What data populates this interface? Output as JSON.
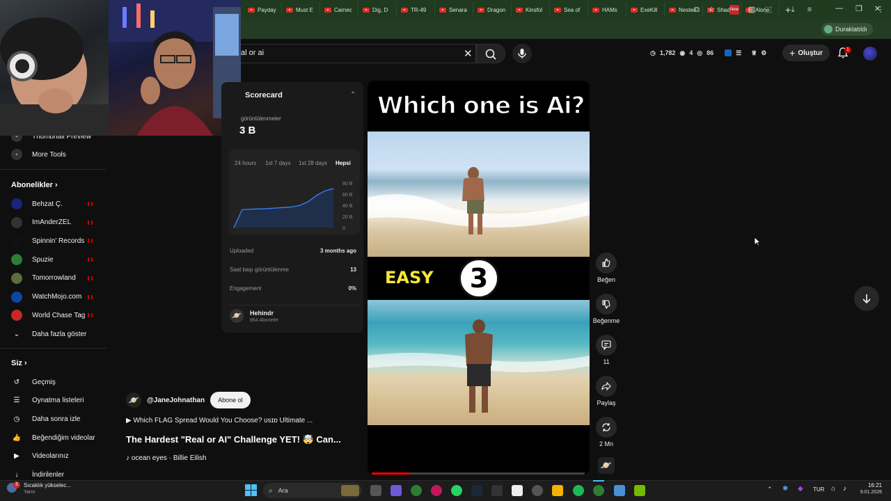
{
  "browser": {
    "tabs": [
      "Payday",
      "Must E",
      "Carnec",
      "Dig, D",
      "TR-49",
      "Senara",
      "Dragon",
      "Kinsfol",
      "Sea of",
      "HAMs",
      "ExeKill",
      "Nestec",
      "Shado",
      "Alone"
    ],
    "profile_label": "Duraklatıldı",
    "new_badge": "New"
  },
  "header": {
    "search_value": "al or ai",
    "stats": {
      "views": "1,782",
      "likes": "4",
      "watchers": "86"
    },
    "create_label": "Oluştur",
    "notification_count": "1"
  },
  "sidebar": {
    "top_items": [
      {
        "label": "Thumbnail Preview",
        "icon": "tool-icon"
      },
      {
        "label": "More Tools",
        "icon": "tool-icon"
      }
    ],
    "subscriptions_title": "Abonelikler",
    "subscriptions": [
      {
        "label": "Behzat Ç.",
        "color": "#1a237e"
      },
      {
        "label": "ImAnderZEL",
        "color": "#333333"
      },
      {
        "label": "Spinnin' Records",
        "color": "#111111"
      },
      {
        "label": "Spuzie",
        "color": "#2e7d32"
      },
      {
        "label": "Tomorrowland",
        "color": "#5d6d3a"
      },
      {
        "label": "WatchMojo.com",
        "color": "#0d47a1"
      },
      {
        "label": "World Chase Tag",
        "color": "#c62828"
      }
    ],
    "show_more_label": "Daha fazla göster",
    "you_title": "Siz",
    "you_items": [
      {
        "label": "Geçmiş",
        "icon": "history-icon"
      },
      {
        "label": "Oynatma listeleri",
        "icon": "playlist-icon"
      },
      {
        "label": "Daha sonra izle",
        "icon": "clock-icon"
      },
      {
        "label": "Beğendiğim videolar",
        "icon": "like-icon"
      },
      {
        "label": "Videolarınız",
        "icon": "video-icon"
      },
      {
        "label": "İndirilenler",
        "icon": "download-icon"
      }
    ]
  },
  "scorecard": {
    "title": "Scorecard",
    "views_label": "görüntülenmeler",
    "views_value": "3 B",
    "ranges": [
      "24 hours",
      "1st 7 days",
      "1st 28 days",
      "Hepsi"
    ],
    "active_range": "Hepsi",
    "rows": [
      {
        "label": "Uploaded",
        "value": "3 months ago"
      },
      {
        "label": "Saat başı görüntülenme",
        "value": "13"
      },
      {
        "label": "Engagement",
        "value": "0%"
      }
    ],
    "channel_name": "Hehindr",
    "channel_subs": "864 Aboneler"
  },
  "chart_data": {
    "type": "area",
    "title": "",
    "ytick_labels": [
      "80 B",
      "60 B",
      "40 B",
      "20 B",
      "0"
    ],
    "ylim": [
      0,
      80
    ],
    "x": [
      0,
      1,
      2,
      3,
      4,
      5,
      6,
      7,
      8,
      9,
      10,
      11,
      12
    ],
    "values": [
      0,
      32,
      33,
      33.5,
      34,
      35,
      36,
      37,
      40,
      47,
      58,
      66,
      70
    ]
  },
  "video": {
    "headline": "Which one is Ai?",
    "easy_label": "EASY",
    "round_number": "3",
    "progress": 0.18
  },
  "actions": [
    {
      "label": "Beğen",
      "icon": "thumbs-up-icon"
    },
    {
      "label": "Beğenme",
      "icon": "thumbs-down-icon"
    },
    {
      "label": "11",
      "icon": "comment-icon"
    },
    {
      "label": "Paylaş",
      "icon": "share-icon"
    },
    {
      "label": "2 Mn",
      "icon": "remix-icon"
    }
  ],
  "meta": {
    "channel_handle": "@JaneJohnathan",
    "subscribe_label": "Abone ol",
    "related": "▶ Which FLAG Spread Would You Choose? υѕɪɒ Ultimate ...",
    "title": "The Hardest \"Real or AI\" Challenge YET! 🤯 Can...",
    "music": "♪ ocean eyes · Billie Eilish"
  },
  "taskbar": {
    "weather_text": "Sıcaklık yükselec...",
    "weather_sub": "Yarın",
    "weather_badge": "3",
    "search_label": "Ara",
    "lang": "TUR",
    "time": "16:21",
    "date": "9.01.2026"
  }
}
